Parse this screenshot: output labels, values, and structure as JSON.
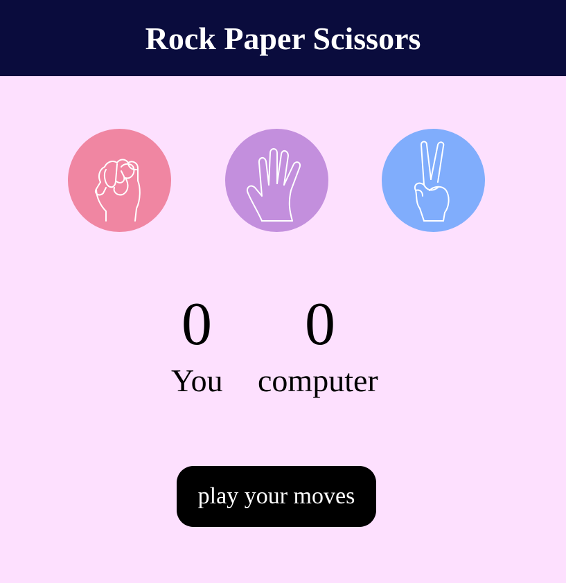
{
  "header": {
    "title": "Rock Paper Scissors"
  },
  "choices": [
    {
      "name": "rock",
      "icon": "fist-icon",
      "color": "#f086a2"
    },
    {
      "name": "paper",
      "icon": "open-hand-icon",
      "color": "#c38fdd"
    },
    {
      "name": "scissors",
      "icon": "peace-sign-icon",
      "color": "#80adfc"
    }
  ],
  "scoreboard": {
    "user_score": "0",
    "user_label": "You",
    "computer_score": "0",
    "computer_label": "computer"
  },
  "play_button": {
    "label": "play your moves"
  },
  "colors": {
    "header_bg": "#0a0c3d",
    "page_bg": "#fde0fe",
    "button_bg": "#000000"
  }
}
